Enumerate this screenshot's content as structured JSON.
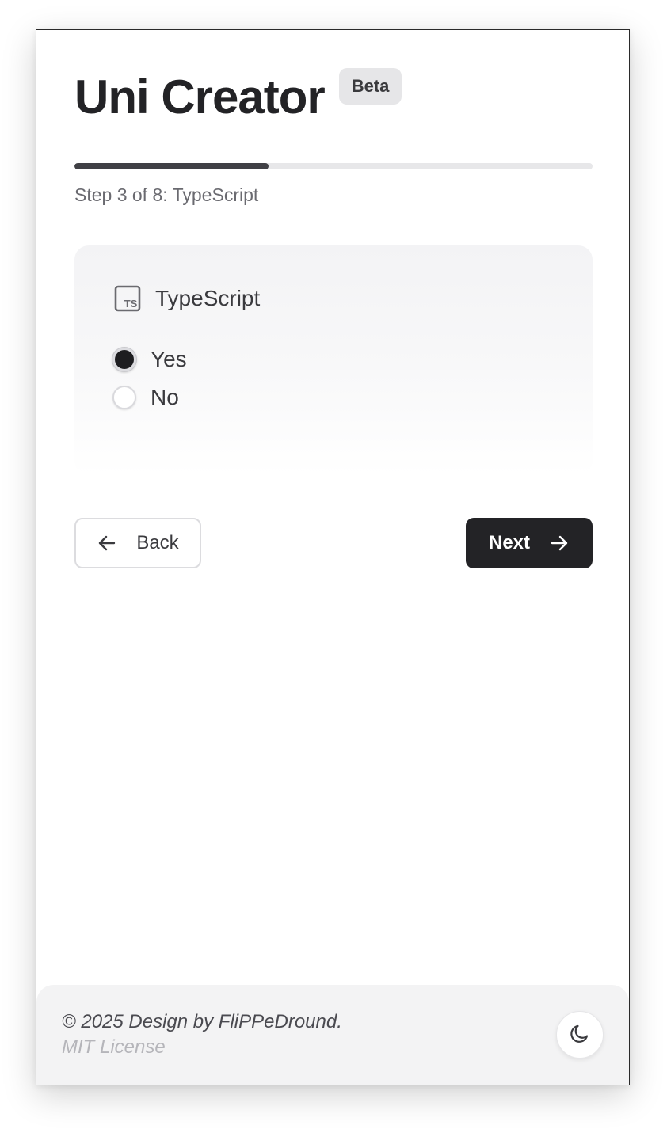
{
  "header": {
    "title": "Uni Creator",
    "badge": "Beta"
  },
  "progress": {
    "current_step": 3,
    "total_steps": 8,
    "fraction": 0.375,
    "label": "Step 3 of 8: TypeScript"
  },
  "question": {
    "icon": "typescript-icon",
    "icon_text": "TS",
    "title": "TypeScript",
    "options": [
      {
        "label": "Yes",
        "checked": true
      },
      {
        "label": "No",
        "checked": false
      }
    ]
  },
  "nav": {
    "back_label": "Back",
    "next_label": "Next"
  },
  "footer": {
    "copyright": "© 2025 Design by FliPPeDround.",
    "license": "MIT License",
    "theme_toggle_icon": "moon-icon"
  },
  "colors": {
    "primary": "#232326",
    "progress_track": "#e7e7e9",
    "progress_fill": "#404045",
    "badge_bg": "#e6e6e8",
    "footer_bg": "#f3f3f4"
  }
}
